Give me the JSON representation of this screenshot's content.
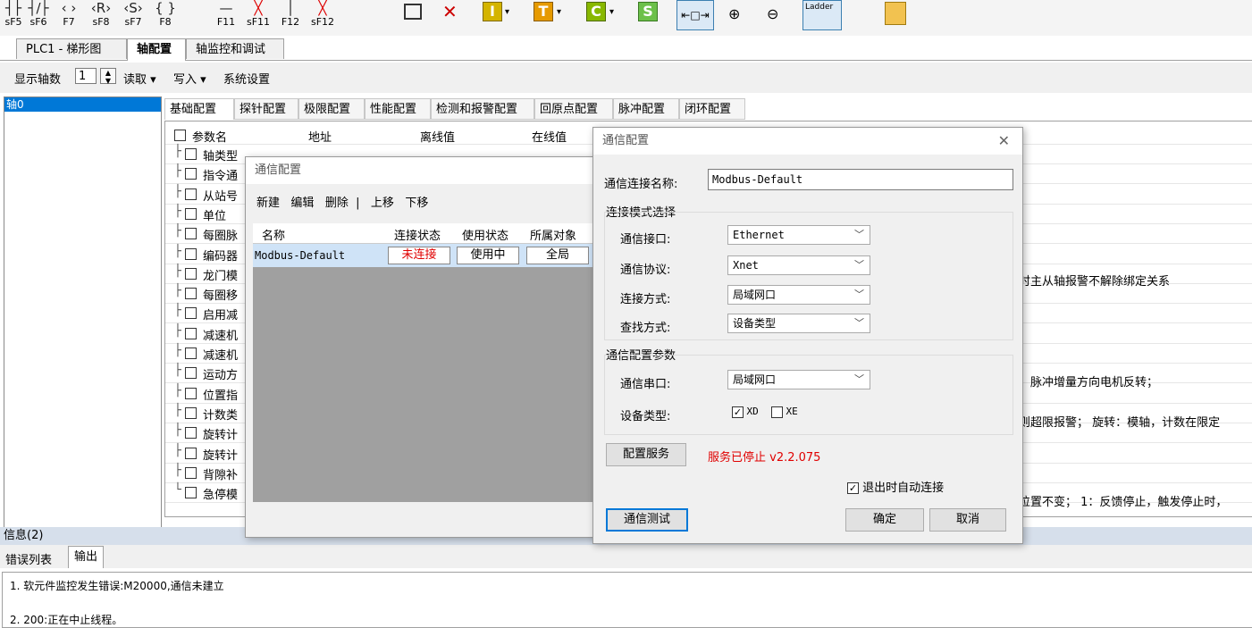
{
  "toolbar": {
    "keys": [
      "sF5",
      "sF6",
      "F7",
      "sF8",
      "sF7",
      "F8",
      "F11",
      "sF11",
      "F12",
      "sF12"
    ],
    "letters": [
      "I",
      "T",
      "C",
      "S"
    ],
    "ladder_label": "Ladder"
  },
  "doc_tabs": [
    "PLC1 - 梯形图",
    "轴配置",
    "轴监控和调试"
  ],
  "axis_bar": {
    "show_axis_label": "显示轴数",
    "axis_count": "1",
    "read": "读取",
    "write": "写入",
    "system": "系统设置"
  },
  "axis_list": [
    "轴0"
  ],
  "config_tabs": [
    "基础配置",
    "探针配置",
    "极限配置",
    "性能配置",
    "检测和报警配置",
    "回原点配置",
    "脉冲配置",
    "闭环配置"
  ],
  "param_table": {
    "headers": [
      "参数名",
      "地址",
      "离线值",
      "在线值"
    ],
    "rows": [
      "轴类型",
      "指令通",
      "从站号",
      "单位",
      "每圈脉",
      "编码器",
      "龙门模",
      "每圈移",
      "启用减",
      "减速机",
      "减速机",
      "运动方",
      "位置指",
      "计数类",
      "旋转计",
      "旋转计",
      "背隙补",
      "急停模"
    ],
    "right_texts": {
      "r6": "时主从轴报警不解除绑定关系",
      "r11": "：脉冲增量方向电机反转；",
      "r13": "则超限报警；  旋转：模轴，计数在限定",
      "r17": "位置不变；  1：反馈停止，触发停止时，"
    }
  },
  "comm_list_dialog": {
    "title": "通信配置",
    "toolbar": [
      "新建",
      "编辑",
      "删除",
      "上移",
      "下移"
    ],
    "headers": [
      "名称",
      "连接状态",
      "使用状态",
      "所属对象"
    ],
    "rows": [
      {
        "name": "Modbus-Default",
        "status": "未连接",
        "usage": "使用中",
        "owner": "全局"
      }
    ]
  },
  "comm_dialog": {
    "title": "通信配置",
    "conn_name_label": "通信连接名称:",
    "conn_name_value": "Modbus-Default",
    "mode_group": "连接模式选择",
    "interface_label": "通信接口:",
    "interface_value": "Ethernet",
    "protocol_label": "通信协议:",
    "protocol_value": "Xnet",
    "conn_method_label": "连接方式:",
    "conn_method_value": "局域网口",
    "search_label": "查找方式:",
    "search_value": "设备类型",
    "params_group": "通信配置参数",
    "port_label": "通信串口:",
    "port_value": "局域网口",
    "device_label": "设备类型:",
    "device_xd": "XD",
    "device_xe": "XE",
    "service_button": "配置服务",
    "service_status": "服务已停止  v2.2.075",
    "auto_connect": "退出时自动连接",
    "test_button": "通信测试",
    "ok_button": "确定",
    "cancel_button": "取消"
  },
  "info": {
    "title": "信息(2)",
    "tabs": [
      "错误列表",
      "输出"
    ],
    "lines": [
      "1. 软元件监控发生错误:M20000,通信未建立",
      "2. 200:正在中止线程。"
    ]
  },
  "colors": {
    "red": "#e00000",
    "accent": "#0078d7"
  }
}
